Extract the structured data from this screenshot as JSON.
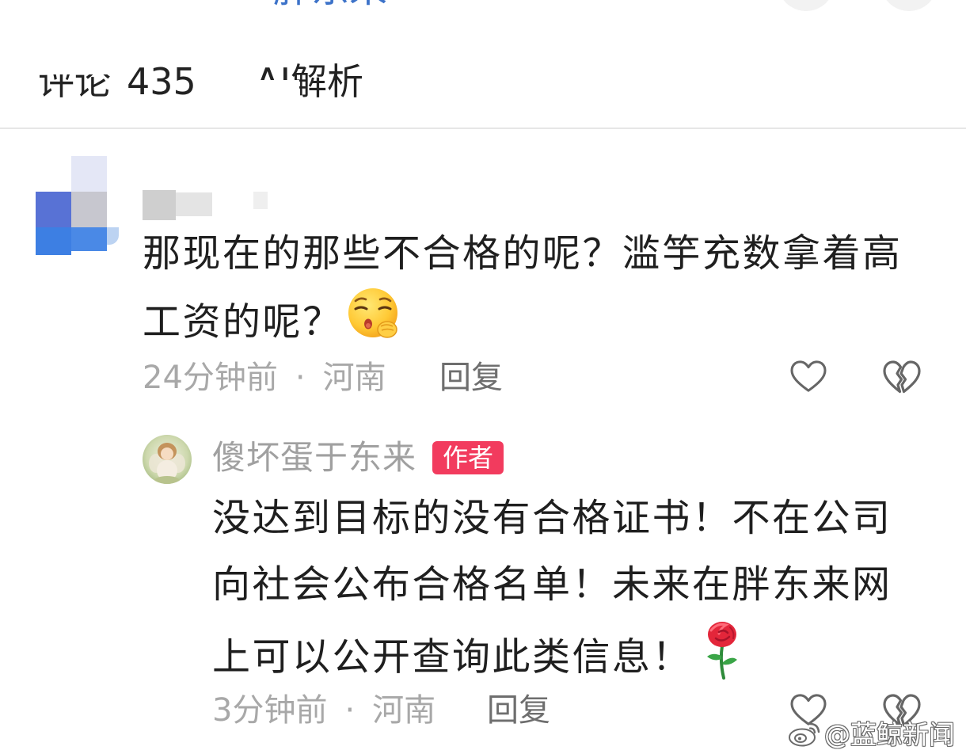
{
  "top": {
    "hashtag": "胖东来"
  },
  "tabs": {
    "comments_label": "评论",
    "comments_count": "435",
    "ai_label": "AI解析"
  },
  "comments": [
    {
      "lines": [
        "那现在的那些不合格的呢？滥竽充数拿着高",
        "工资的呢？"
      ],
      "emoji": "sleepy-face-emoji",
      "time": "24分钟前",
      "separator": "·",
      "location": "河南",
      "reply_label": "回复",
      "like_icon": "heart-icon",
      "dislike_icon": "broken-heart-icon"
    }
  ],
  "replies": [
    {
      "author": "傻坏蛋于东来",
      "badge": "作者",
      "lines": [
        "没达到目标的没有合格证书！不在公司",
        "向社会公布合格名单！未来在胖东来网",
        "上可以公开查询此类信息！"
      ],
      "emoji": "rose-emoji",
      "time": "3分钟前",
      "separator": "·",
      "location": "河南",
      "reply_label": "回复",
      "like_icon": "heart-icon",
      "dislike_icon": "broken-heart-icon"
    }
  ],
  "watermark": {
    "logo": "weibo-logo-icon",
    "text": "@蓝鲸新闻"
  },
  "colors": {
    "text_primary": "#1f1f1f",
    "text_secondary": "#a8a8a8",
    "reply_link": "#6e6e6e",
    "author_gray": "#a0a0a0",
    "badge_bg": "#f23b5e",
    "hashtag_blue": "#3d73c9",
    "divider": "#e6e6e6",
    "icon": "#666666"
  }
}
